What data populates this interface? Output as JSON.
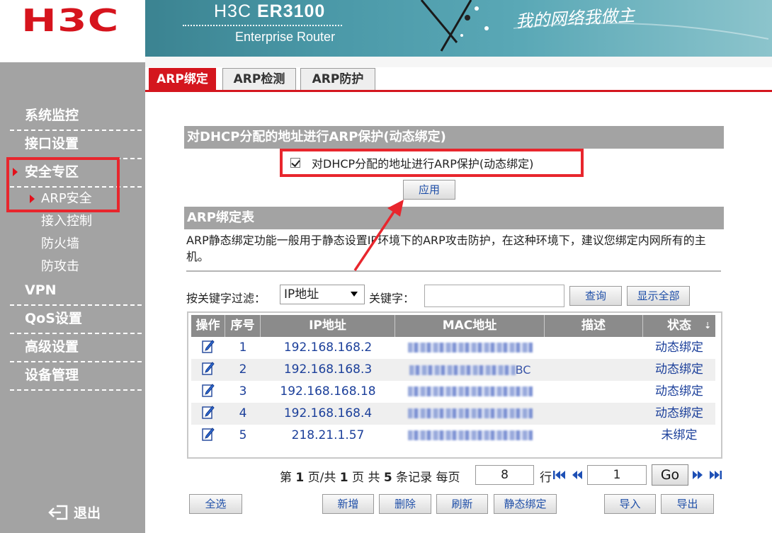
{
  "brand": {
    "logo": "H3C",
    "product_prefix": "H3C ",
    "product_model": "ER3100",
    "product_subtitle": "Enterprise Router",
    "slogan": "我的网络我做主"
  },
  "sidebar": {
    "items": [
      {
        "label": "系统监控"
      },
      {
        "label": "接口设置"
      },
      {
        "label": "安全专区"
      },
      {
        "label": "VPN"
      },
      {
        "label": "QoS设置"
      },
      {
        "label": "高级设置"
      },
      {
        "label": "设备管理"
      }
    ],
    "subitems": [
      {
        "label": "ARP安全"
      },
      {
        "label": "接入控制"
      },
      {
        "label": "防火墙"
      },
      {
        "label": "防攻击"
      }
    ],
    "logout": "退出"
  },
  "tabs": [
    {
      "label": "ARP绑定"
    },
    {
      "label": "ARP检测"
    },
    {
      "label": "ARP防护"
    }
  ],
  "dhcp": {
    "section_title": "对DHCP分配的地址进行ARP保护(动态绑定)",
    "checkbox_label": "对DHCP分配的地址进行ARP保护(动态绑定)",
    "checked": true,
    "apply_label": "应用"
  },
  "arp_table_section": {
    "title": "ARP绑定表",
    "description": "ARP静态绑定功能一般用于静态设置IP环境下的ARP攻击防护，在这种环境下，建议您绑定内网所有的主机。"
  },
  "filter": {
    "by_label": "按关键字过滤：",
    "select_value": "IP地址",
    "keyword_label": "关键字：",
    "keyword_value": "",
    "query_label": "查询",
    "show_all_label": "显示全部"
  },
  "table": {
    "headers": [
      "操作",
      "序号",
      "IP地址",
      "MAC地址",
      "描述",
      "状态"
    ],
    "rows": [
      {
        "index": "1",
        "ip": "192.168.168.2",
        "mac_tail": "",
        "desc": "",
        "status": "动态绑定"
      },
      {
        "index": "2",
        "ip": "192.168.168.3",
        "mac_tail": "BC",
        "desc": "",
        "status": "动态绑定"
      },
      {
        "index": "3",
        "ip": "192.168.168.18",
        "mac_tail": "",
        "desc": "",
        "status": "动态绑定"
      },
      {
        "index": "4",
        "ip": "192.168.168.4",
        "mac_tail": "",
        "desc": "",
        "status": "动态绑定"
      },
      {
        "index": "5",
        "ip": "218.21.1.57",
        "mac_tail": "",
        "desc": "",
        "status": "未绑定"
      }
    ]
  },
  "pager": {
    "prefix_page": "第",
    "current_page": "1",
    "page_sep": "页/共",
    "total_pages": "1",
    "records_prefix": "页 共",
    "total_records": "5",
    "records_suffix": "条记录 每页",
    "per_page": "8",
    "row_label": "行",
    "goto_value": "1",
    "go_label": "Go"
  },
  "actions": {
    "select_all": "全选",
    "add": "新增",
    "delete": "删除",
    "refresh": "刷新",
    "static_bind": "静态绑定",
    "import": "导入",
    "export": "导出"
  },
  "colors": {
    "brand_red": "#d4161e",
    "sidebar_gray": "#a3a3a3",
    "link_blue": "#1b3f9a",
    "highlight_red": "#e8262d"
  }
}
